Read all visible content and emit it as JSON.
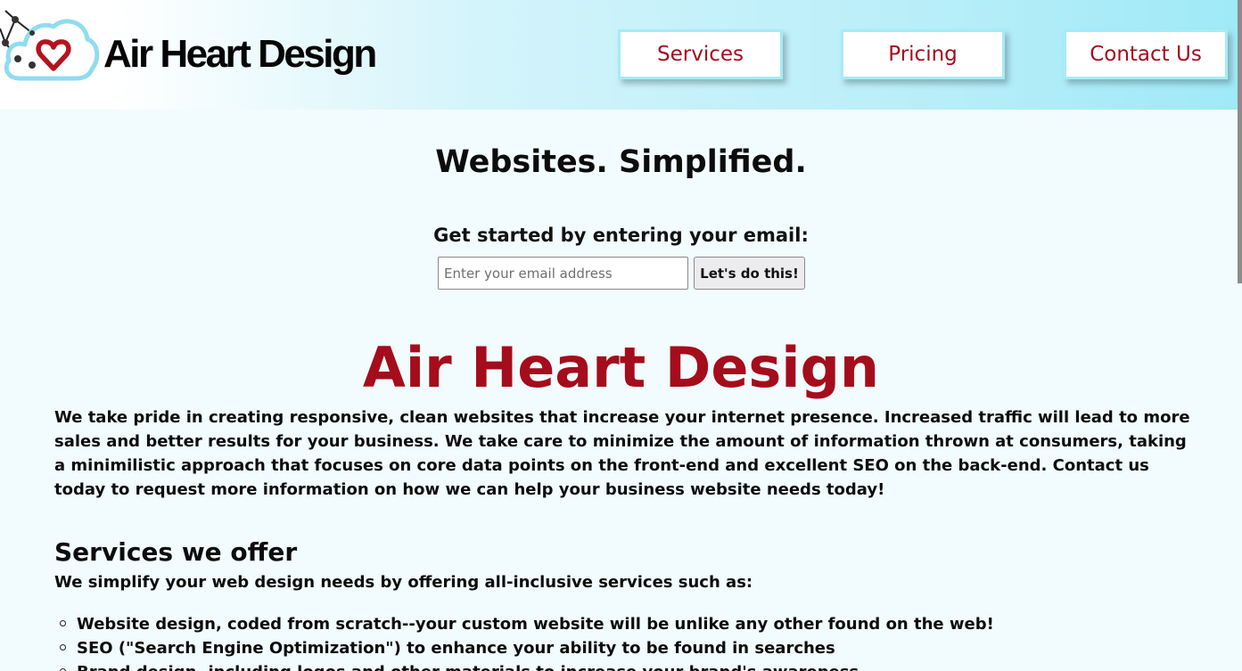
{
  "header": {
    "logo_text": "Air Heart Design",
    "nav": [
      {
        "label": "Services"
      },
      {
        "label": "Pricing"
      },
      {
        "label": "Contact Us"
      }
    ]
  },
  "hero": {
    "tagline": "Websites. Simplified.",
    "get_started": "Get started by entering your email:",
    "email_placeholder": "Enter your email address",
    "submit_label": "Let's do this!"
  },
  "about": {
    "title": "Air Heart Design",
    "paragraph": "We take pride in creating responsive, clean websites that increase your internet presence. Increased traffic will lead to more sales and better results for your business. We take care to minimize the amount of information thrown at consumers, taking a minimilistic approach that focuses on core data points on the front-end and excellent SEO on the back-end. Contact us today to request more information on how we can help your business website needs today!"
  },
  "services": {
    "heading": "Services we offer",
    "subheading": "We simplify your web design needs by offering all-inclusive services such as:",
    "items": [
      {
        "label": "Website design, coded from scratch--your custom website will be unlike any other found on the web!"
      },
      {
        "label": "SEO (\"Search Engine Optimization\") to enhance your ability to be found in searches"
      },
      {
        "label": "Brand design, including logos and other materials to increase your brand's awareness"
      }
    ]
  },
  "colors": {
    "brand_red": "#a50c1c",
    "accent_cyan": "#a6ebf6",
    "background": "#f2fbfd"
  },
  "icons": {
    "logo": "cloud-heart-network-icon",
    "bullet": "circle-bullet-icon"
  }
}
